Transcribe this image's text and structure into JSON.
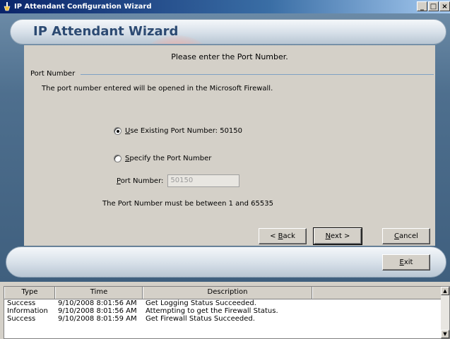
{
  "window": {
    "title": "IP Attendant Configuration Wizard",
    "minimize": "_",
    "restore": "□",
    "close": "×"
  },
  "header": {
    "title": "IP Attendant Wizard"
  },
  "prompt": "Please enter the Port Number.",
  "group": {
    "label": "Port Number",
    "description": "The port number entered will be opened in the Microsoft Firewall."
  },
  "options": {
    "existing_key": "U",
    "existing_label": "se Existing Port Number:  50150",
    "existing_selected": true,
    "specify_key": "S",
    "specify_label": "pecify the Port Number",
    "specify_selected": false
  },
  "port_field": {
    "label_key": "P",
    "label": "ort Number:",
    "value": "50150"
  },
  "range_note": "The Port Number must be between 1 and 65535",
  "buttons": {
    "back_prefix": "< ",
    "back_key": "B",
    "back_rest": "ack",
    "next_key": "N",
    "next_rest": "ext >",
    "cancel_key": "C",
    "cancel_rest": "ancel",
    "exit_key": "E",
    "exit_rest": "xit"
  },
  "log": {
    "columns": [
      "Type",
      "Time",
      "Description",
      ""
    ],
    "rows": [
      {
        "type": "Success",
        "time": "9/10/2008 8:01:56 AM",
        "description": "Get Logging Status Succeeded."
      },
      {
        "type": "Information",
        "time": "9/10/2008 8:01:56 AM",
        "description": "Attempting to get the Firewall Status."
      },
      {
        "type": "Success",
        "time": "9/10/2008 8:01:59 AM",
        "description": "Get Firewall Status Succeeded."
      }
    ],
    "scroll_up": "▲",
    "scroll_down": "▼"
  }
}
